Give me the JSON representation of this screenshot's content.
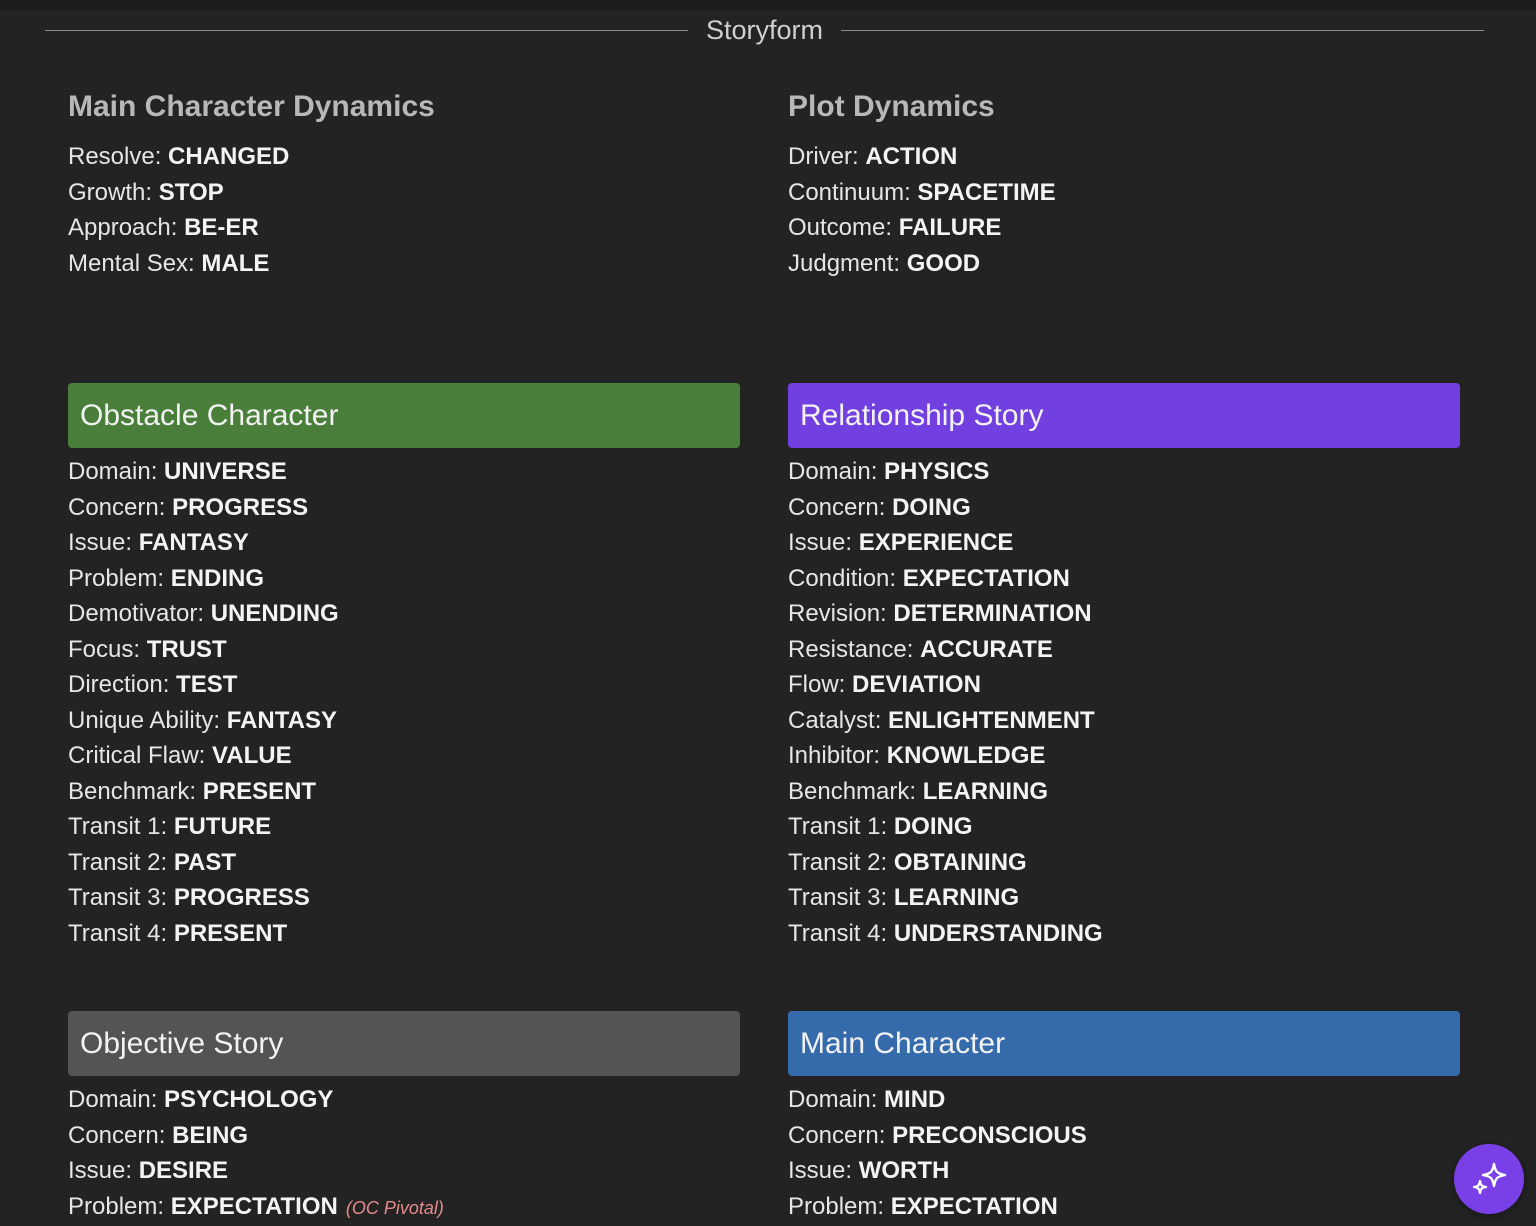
{
  "header": {
    "title": "Storyform"
  },
  "main_character_dynamics": {
    "title": "Main Character Dynamics",
    "rows": [
      {
        "label": "Resolve:",
        "value": "CHANGED"
      },
      {
        "label": "Growth:",
        "value": "STOP"
      },
      {
        "label": "Approach:",
        "value": "BE-ER"
      },
      {
        "label": "Mental Sex:",
        "value": "MALE"
      }
    ]
  },
  "plot_dynamics": {
    "title": "Plot Dynamics",
    "rows": [
      {
        "label": "Driver:",
        "value": "ACTION"
      },
      {
        "label": "Continuum:",
        "value": "SPACETIME"
      },
      {
        "label": "Outcome:",
        "value": "FAILURE"
      },
      {
        "label": "Judgment:",
        "value": "GOOD"
      }
    ]
  },
  "obstacle_character": {
    "title": "Obstacle Character",
    "color": "#4a7f3b",
    "rows": [
      {
        "label": "Domain:",
        "value": "UNIVERSE"
      },
      {
        "label": "Concern:",
        "value": "PROGRESS"
      },
      {
        "label": "Issue:",
        "value": "FANTASY"
      },
      {
        "label": "Problem:",
        "value": "ENDING"
      },
      {
        "label": "Demotivator:",
        "value": "UNENDING"
      },
      {
        "label": "Focus:",
        "value": "TRUST"
      },
      {
        "label": "Direction:",
        "value": "TEST"
      },
      {
        "label": "Unique Ability:",
        "value": "FANTASY"
      },
      {
        "label": "Critical Flaw:",
        "value": "VALUE"
      },
      {
        "label": "Benchmark:",
        "value": "PRESENT"
      },
      {
        "label": "Transit 1:",
        "value": "FUTURE"
      },
      {
        "label": "Transit 2:",
        "value": "PAST"
      },
      {
        "label": "Transit 3:",
        "value": "PROGRESS"
      },
      {
        "label": "Transit 4:",
        "value": "PRESENT"
      }
    ]
  },
  "relationship_story": {
    "title": "Relationship Story",
    "color": "#7240e0",
    "rows": [
      {
        "label": "Domain:",
        "value": "PHYSICS"
      },
      {
        "label": "Concern:",
        "value": "DOING"
      },
      {
        "label": "Issue:",
        "value": "EXPERIENCE"
      },
      {
        "label": "Condition:",
        "value": "EXPECTATION"
      },
      {
        "label": "Revision:",
        "value": "DETERMINATION"
      },
      {
        "label": "Resistance:",
        "value": "ACCURATE"
      },
      {
        "label": "Flow:",
        "value": "DEVIATION"
      },
      {
        "label": "Catalyst:",
        "value": "ENLIGHTENMENT"
      },
      {
        "label": "Inhibitor:",
        "value": "KNOWLEDGE"
      },
      {
        "label": "Benchmark:",
        "value": "LEARNING"
      },
      {
        "label": "Transit 1:",
        "value": "DOING"
      },
      {
        "label": "Transit 2:",
        "value": "OBTAINING"
      },
      {
        "label": "Transit 3:",
        "value": "LEARNING"
      },
      {
        "label": "Transit 4:",
        "value": "UNDERSTANDING"
      }
    ]
  },
  "objective_story": {
    "title": "Objective Story",
    "color": "#545454",
    "rows": [
      {
        "label": "Domain:",
        "value": "PSYCHOLOGY"
      },
      {
        "label": "Concern:",
        "value": "BEING"
      },
      {
        "label": "Issue:",
        "value": "DESIRE"
      },
      {
        "label": "Problem:",
        "value": "EXPECTATION"
      }
    ],
    "pivotal_note": "(OC Pivotal)",
    "pivotal_color": "#e48b8b"
  },
  "main_character": {
    "title": "Main Character",
    "color": "#356aab",
    "rows": [
      {
        "label": "Domain:",
        "value": "MIND"
      },
      {
        "label": "Concern:",
        "value": "PRECONSCIOUS"
      },
      {
        "label": "Issue:",
        "value": "WORTH"
      },
      {
        "label": "Problem:",
        "value": "EXPECTATION"
      }
    ]
  },
  "assistant_button": {
    "icon": "sparkles-icon",
    "color": "#7a40e8"
  }
}
